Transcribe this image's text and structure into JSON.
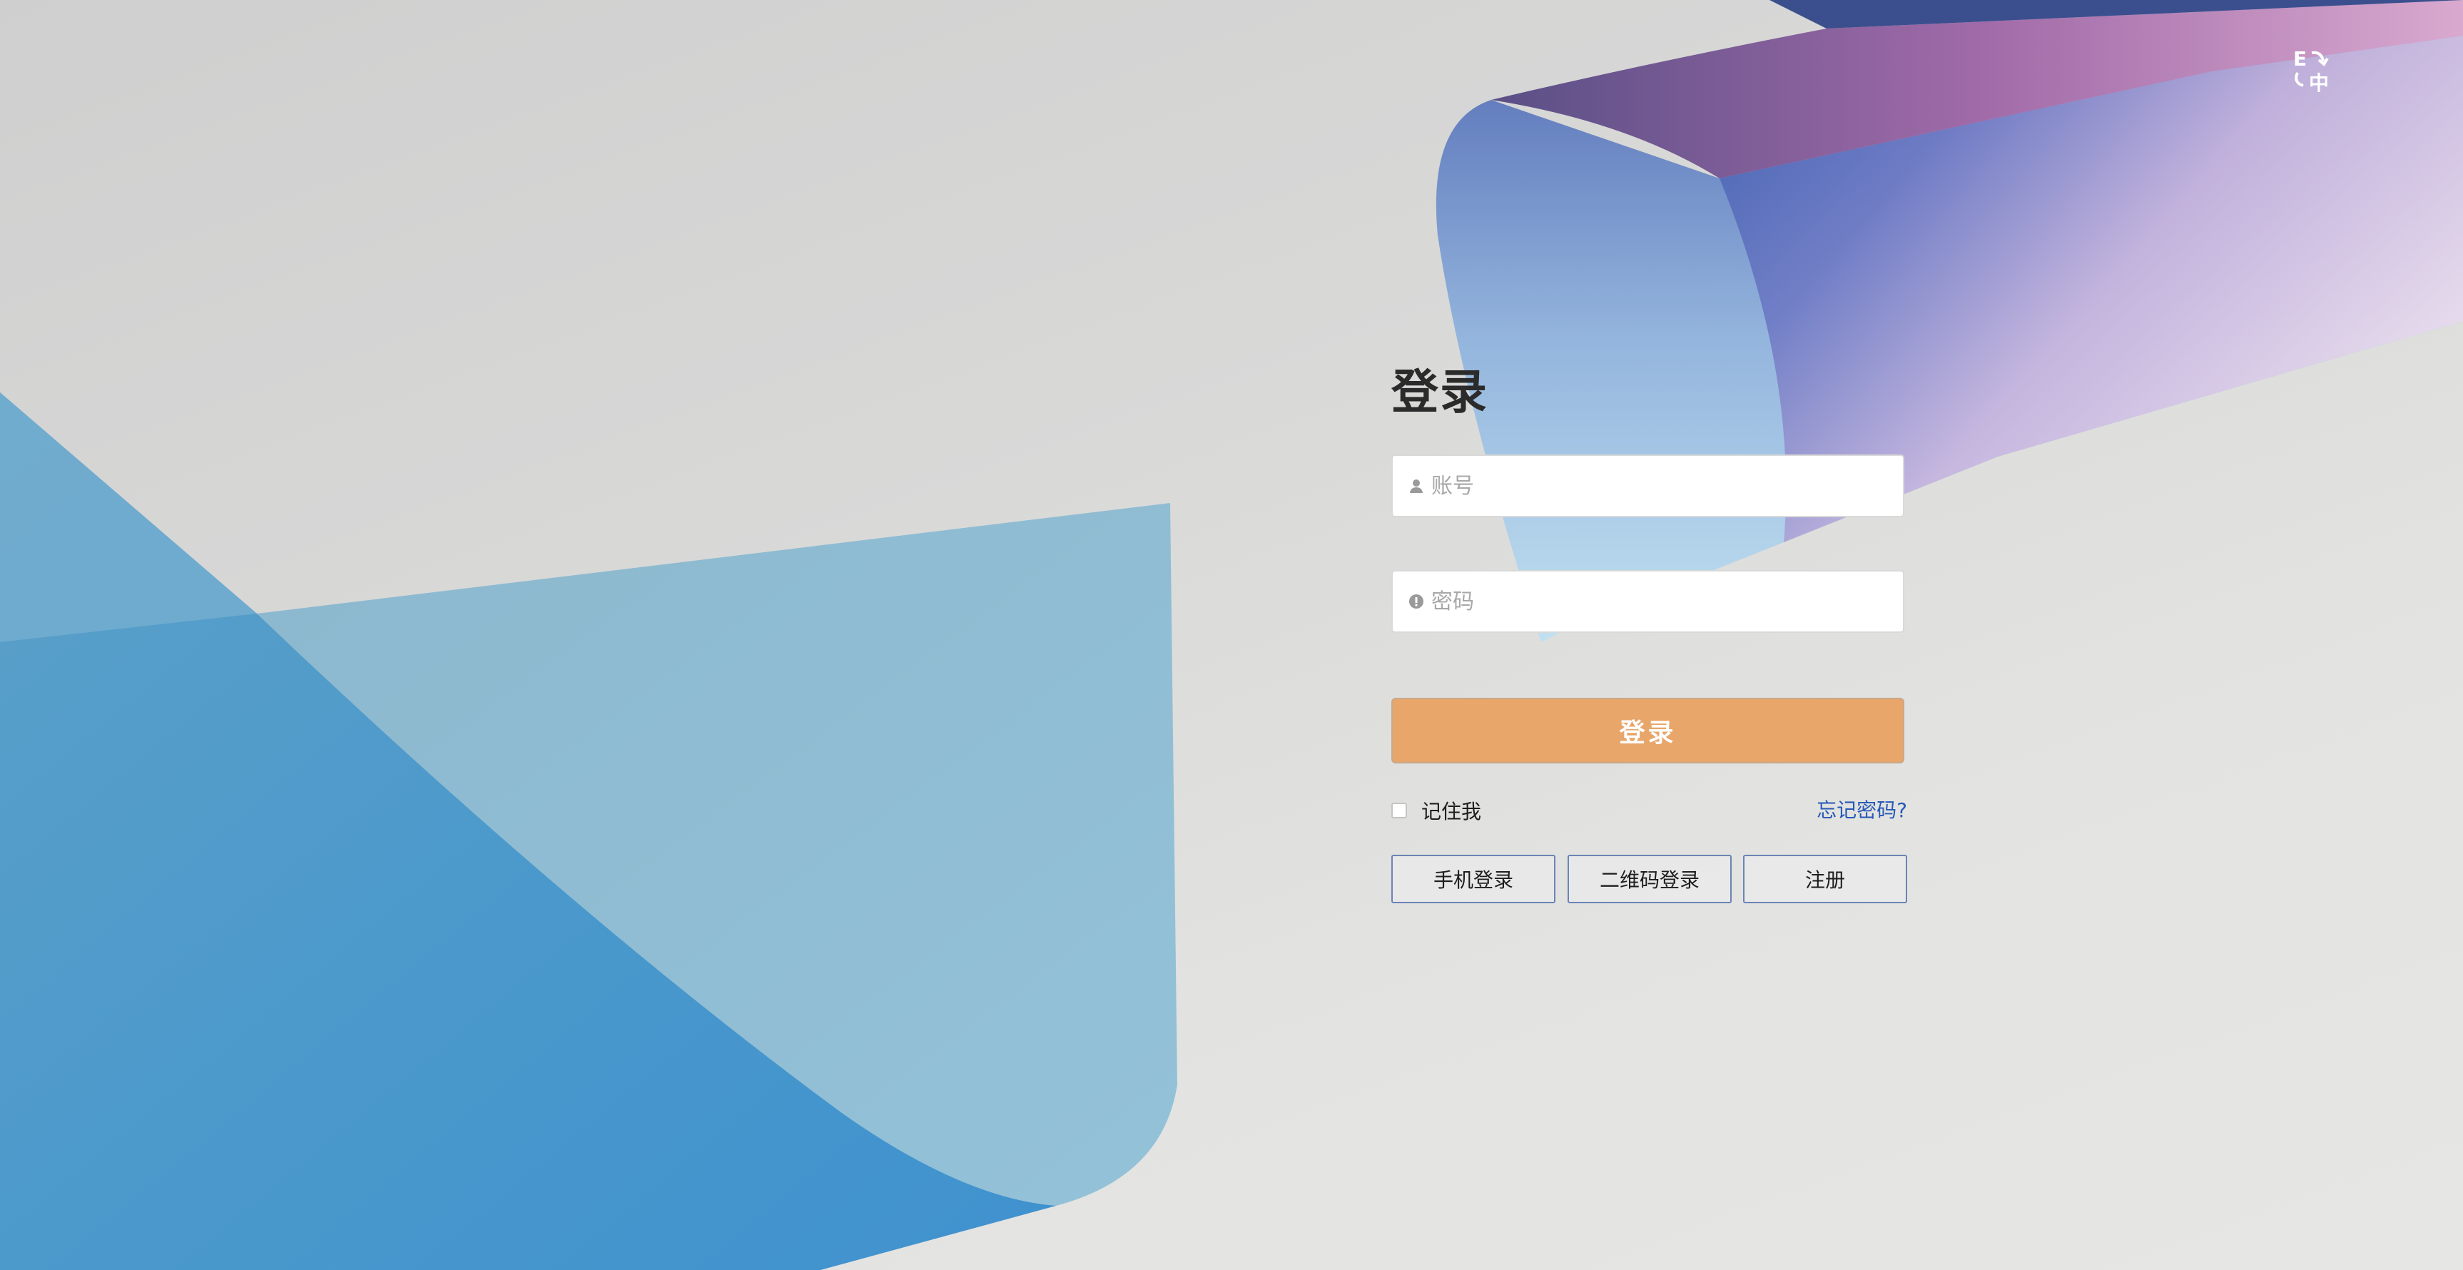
{
  "header": {
    "language_switch_icon": "language-switch-icon"
  },
  "login": {
    "title": "登录",
    "account_placeholder": "账号",
    "account_value": "",
    "account_icon": "user-icon",
    "password_placeholder": "密码",
    "password_value": "",
    "password_icon": "lock-icon",
    "submit_label": "登录",
    "remember_label": "记住我",
    "remember_checked": false,
    "forgot_label": "忘记密码?",
    "phone_login_label": "手机登录",
    "qr_login_label": "二维码登录",
    "register_label": "注册"
  },
  "colors": {
    "primary_button": "#e8a66b",
    "link": "#2659b8",
    "secondary_button_border": "#6b84b8",
    "title": "#2b2b2b"
  }
}
